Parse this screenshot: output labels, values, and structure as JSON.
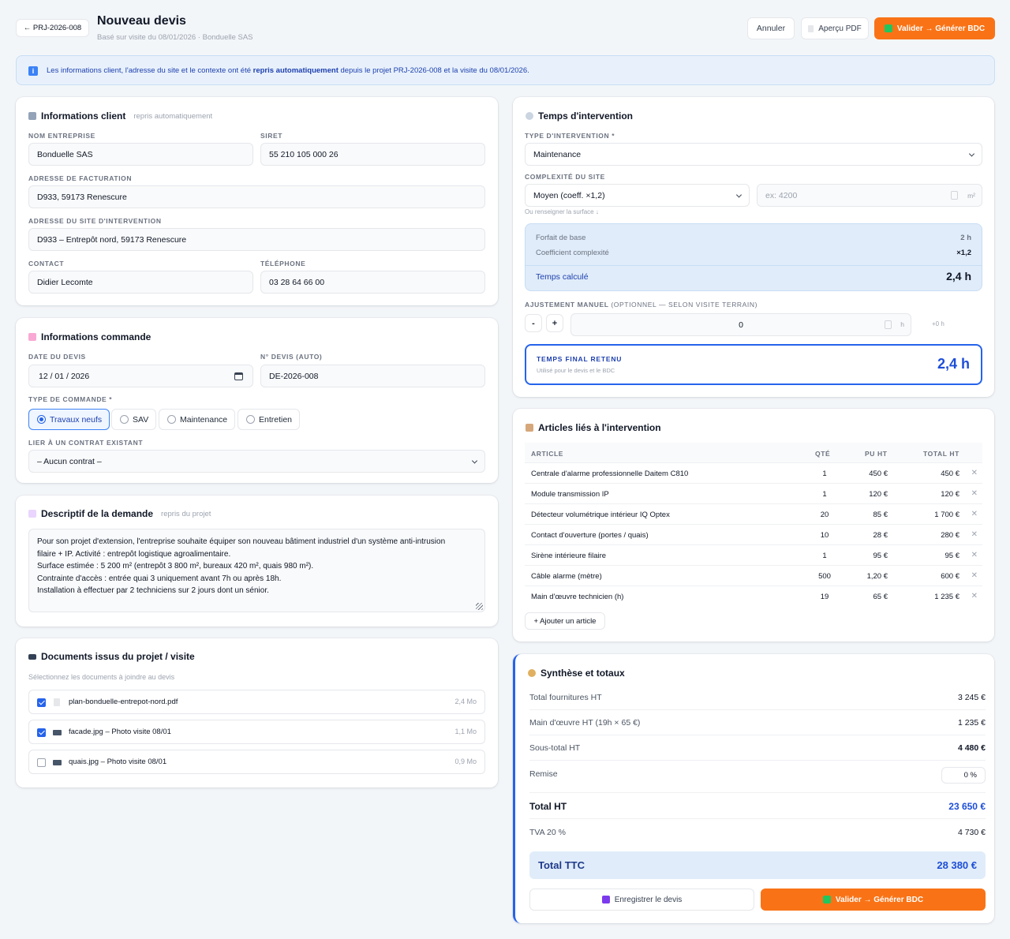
{
  "header": {
    "back_label": "← PRJ-2026-008",
    "title": "Nouveau devis",
    "subtitle": "Basé sur visite du 08/01/2026 · Bonduelle SAS",
    "cancel_label": "Annuler",
    "preview_label": "Aperçu PDF",
    "validate_label": "Valider → Générer BDC"
  },
  "banner": {
    "text_before": "Les informations client, l'adresse du site et le contexte ont été",
    "text_bold": "repris automatiquement",
    "text_after": "depuis le projet PRJ-2026-008 et la visite du 08/01/2026."
  },
  "client": {
    "title": "Informations client",
    "note": "repris automatiquement",
    "company_label": "Nom entreprise",
    "company": "Bonduelle SAS",
    "siret_label": "SIRET",
    "siret": "55 210 105 000 26",
    "billing_label": "Adresse de facturation",
    "billing": "D933, 59173 Renescure",
    "site_label": "Adresse du site d'intervention",
    "site": "D933 – Entrepôt nord, 59173 Renescure",
    "contact_label": "Contact",
    "contact": "Didier Lecomte",
    "phone_label": "Téléphone",
    "phone": "03 28 64 66 00"
  },
  "order": {
    "title": "Informations commande",
    "date_label": "Date du devis",
    "date": "12 / 01 / 2026",
    "number_label": "N° devis (auto)",
    "number": "DE-2026-008",
    "type_label": "Type de commande *",
    "types": [
      "Travaux neufs",
      "SAV",
      "Maintenance",
      "Entretien"
    ],
    "selected_type": "Travaux neufs",
    "contract_label": "Lier à un contrat existant",
    "contract": "– Aucun contrat –"
  },
  "description": {
    "title": "Descriptif de la demande",
    "note": "repris du projet",
    "lines": [
      "Pour son projet d'extension, l'entreprise souhaite équiper son nouveau bâtiment industriel d'un système anti-intrusion",
      "filaire + IP. Activité : entrepôt logistique agroalimentaire.",
      "Surface estimée : 5 200 m² (entrepôt 3 800 m², bureaux 420 m², quais 980 m²).",
      "Contrainte d'accès : entrée quai 3 uniquement avant 7h ou après 18h.",
      "Installation à effectuer par 2 techniciens sur 2 jours dont un sénior."
    ]
  },
  "documents": {
    "title": "Documents issus du projet / visite",
    "hint": "Sélectionnez les documents à joindre au devis",
    "items": [
      {
        "name": "plan-bonduelle-entrepot-nord.pdf",
        "size": "2,4 Mo",
        "checked": true,
        "icon": "pdf-file-icon"
      },
      {
        "name": "facade.jpg – Photo visite 08/01",
        "size": "1,1 Mo",
        "checked": true,
        "icon": "camera-icon"
      },
      {
        "name": "quais.jpg – Photo visite 08/01",
        "size": "0,9 Mo",
        "checked": false,
        "icon": "camera-icon"
      }
    ]
  },
  "time": {
    "title": "Temps d'intervention",
    "type_label": "Type d'intervention *",
    "type": "Maintenance",
    "complexity_label": "Complexité du site",
    "complexity": "Moyen (coeff. ×1,2)",
    "surface_placeholder": "ex: 4200",
    "surface_unit": "m²",
    "surface_hint": "Ou renseigner la surface ↓",
    "base_label": "Forfait de base",
    "base_value": "2 h",
    "coeff_label": "Coefficient complexité",
    "coeff_value": "×1,2",
    "computed_label": "Temps calculé",
    "computed_value": "2,4 h",
    "adjust_label": "Ajustement manuel",
    "adjust_note": "(optionnel — selon visite terrain)",
    "minus": "-",
    "plus": "+",
    "adjust_value": "0",
    "adjust_unit": "h",
    "adjust_delta": "+0 h",
    "final_label": "Temps final retenu",
    "final_hint": "Utilisé pour le devis et le BDC",
    "final_value": "2,4 h"
  },
  "articles": {
    "title": "Articles liés à l'intervention",
    "headers": {
      "article": "Article",
      "qty": "Qté",
      "unit": "PU HT",
      "total": "Total HT"
    },
    "rows": [
      {
        "name": "Centrale d'alarme professionnelle Daitem C810",
        "qty": "1",
        "unit": "450 €",
        "total": "450 €"
      },
      {
        "name": "Module transmission IP",
        "qty": "1",
        "unit": "120 €",
        "total": "120 €"
      },
      {
        "name": "Détecteur volumétrique intérieur IQ Optex",
        "qty": "20",
        "unit": "85 €",
        "total": "1 700 €"
      },
      {
        "name": "Contact d'ouverture (portes / quais)",
        "qty": "10",
        "unit": "28 €",
        "total": "280 €"
      },
      {
        "name": "Sirène intérieure filaire",
        "qty": "1",
        "unit": "95 €",
        "total": "95 €"
      },
      {
        "name": "Câble alarme (mètre)",
        "qty": "500",
        "unit": "1,20 €",
        "total": "600 €"
      },
      {
        "name": "Main d'œuvre technicien (h)",
        "qty": "19",
        "unit": "65 €",
        "total": "1 235 €"
      }
    ],
    "add_label": "+ Ajouter un article"
  },
  "summary": {
    "title": "Synthèse et totaux",
    "supplies_label": "Total fournitures HT",
    "supplies": "3 245 €",
    "labor_label": "Main d'œuvre HT (19h × 65 €)",
    "labor": "1 235 €",
    "subtotal_label": "Sous-total HT",
    "subtotal": "4 480 €",
    "discount_label": "Remise",
    "discount": "0 %",
    "total_ht_label": "Total HT",
    "total_ht": "23 650 €",
    "vat_label": "TVA 20 %",
    "vat": "4 730 €",
    "total_ttc_label": "Total TTC",
    "total_ttc": "28 380 €",
    "save_label": "Enregistrer le devis",
    "validate_label": "Valider → Générer BDC"
  },
  "colors": {
    "accent": "#f97316",
    "primary": "#1d4ed8",
    "info_bg": "#e0ecf9"
  }
}
